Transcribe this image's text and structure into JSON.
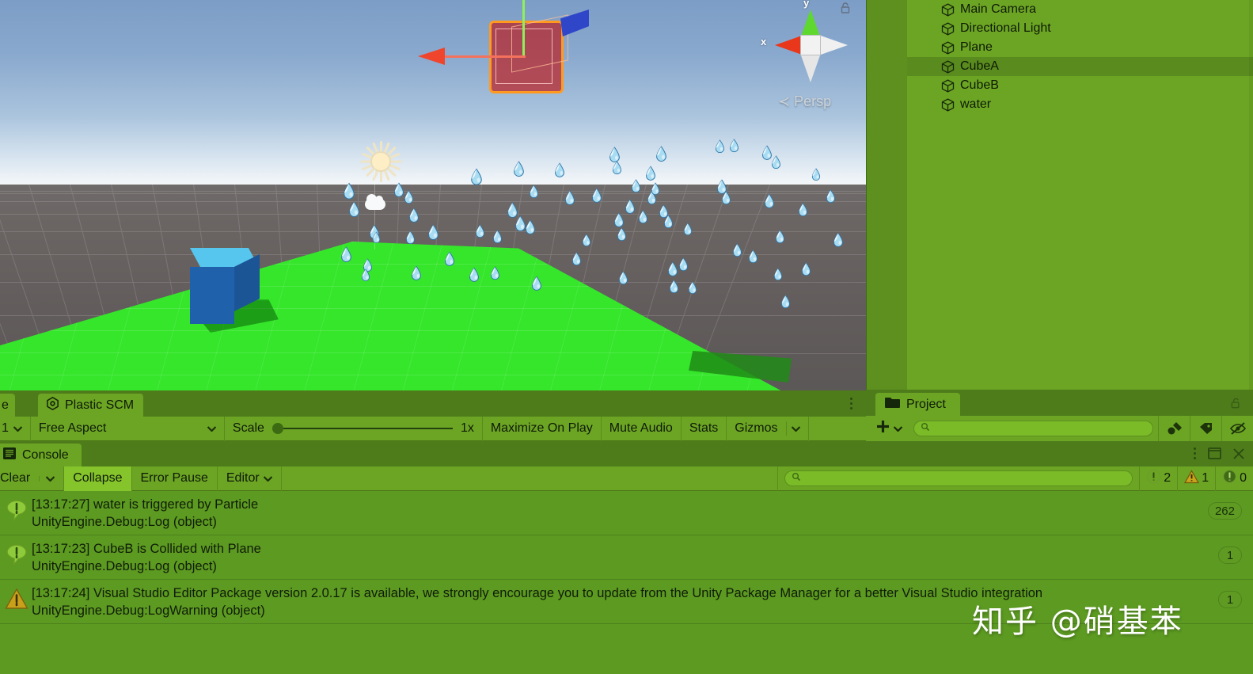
{
  "scene": {
    "orientation_gizmo": {
      "y_label": "y",
      "x_label": "x",
      "projection": "Persp",
      "persp_arrow": "≺"
    },
    "selected_object": "CubeA"
  },
  "hierarchy": {
    "items": [
      {
        "label": "Main Camera",
        "icon": "cube-icon",
        "selected": false
      },
      {
        "label": "Directional Light",
        "icon": "cube-icon",
        "selected": false
      },
      {
        "label": "Plane",
        "icon": "cube-icon",
        "selected": false
      },
      {
        "label": "CubeA",
        "icon": "cube-icon",
        "selected": true
      },
      {
        "label": "CubeB",
        "icon": "cube-icon",
        "selected": false
      },
      {
        "label": "water",
        "icon": "cube-icon",
        "selected": false
      }
    ]
  },
  "game_view": {
    "prev_tab_label": "e",
    "tab_label": "Plastic SCM",
    "tab_icon": "plastic-scm-icon",
    "kebab_icon": "kebab-menu-icon",
    "display_value": "1",
    "aspect_value": "Free Aspect",
    "scale_label": "Scale",
    "scale_value": "1x",
    "maximize_label": "Maximize On Play",
    "mute_label": "Mute Audio",
    "stats_label": "Stats",
    "gizmos_label": "Gizmos"
  },
  "project": {
    "tab_label": "Project",
    "tab_icon": "folder-icon",
    "lock_icon": "lock-open-icon",
    "add_label": "+",
    "search_placeholder": "",
    "icons": [
      "favorites-icon",
      "label-icon",
      "hidden-eye-icon"
    ]
  },
  "console": {
    "tab_label": "Console",
    "tab_icon": "console-icon",
    "window_buttons": [
      "kebab-menu-icon",
      "maximize-icon",
      "close-icon"
    ],
    "toolbar": {
      "clear_label": "Clear",
      "clear_dropdown_icon": "chevron-down-icon",
      "collapse_label": "Collapse",
      "collapse_active": true,
      "error_pause_label": "Error Pause",
      "editor_label": "Editor",
      "editor_dropdown_icon": "chevron-down-icon",
      "search_placeholder": ""
    },
    "counters": [
      {
        "type": "log",
        "icon": "log-icon",
        "value": "2"
      },
      {
        "type": "warning",
        "icon": "warning-icon",
        "value": "1"
      },
      {
        "type": "error",
        "icon": "error-icon",
        "value": "0"
      }
    ],
    "messages": [
      {
        "icon": "log-icon",
        "line1": "[13:17:27] water is triggered by Particle",
        "line2": "UnityEngine.Debug:Log (object)",
        "count": "262"
      },
      {
        "icon": "log-icon",
        "line1": "[13:17:23] CubeB is Collided with Plane",
        "line2": "UnityEngine.Debug:Log (object)",
        "count": "1"
      },
      {
        "icon": "warning-icon",
        "line1": "[13:17:24] Visual Studio Editor Package version 2.0.17 is available, we strongly encourage you to update from the Unity Package Manager for a better Visual Studio integration",
        "line2": "UnityEngine.Debug:LogWarning (object)",
        "count": "1"
      }
    ]
  },
  "watermark": {
    "text": "知乎 @硝基苯"
  },
  "colors": {
    "panel_green": "#6ca524",
    "panel_dark_green": "#4e7c1b",
    "console_green": "#5c9a21",
    "selected_row": "#5a8b1e",
    "accent_active": "#86c42c",
    "plane_green": "#35e62b",
    "cube_blue": "#1f62ab",
    "gizmo_x": "#e8371a",
    "gizmo_y": "#5ed82f",
    "gizmo_z": "#2f46c9",
    "select_outline": "#ff9a1f"
  }
}
